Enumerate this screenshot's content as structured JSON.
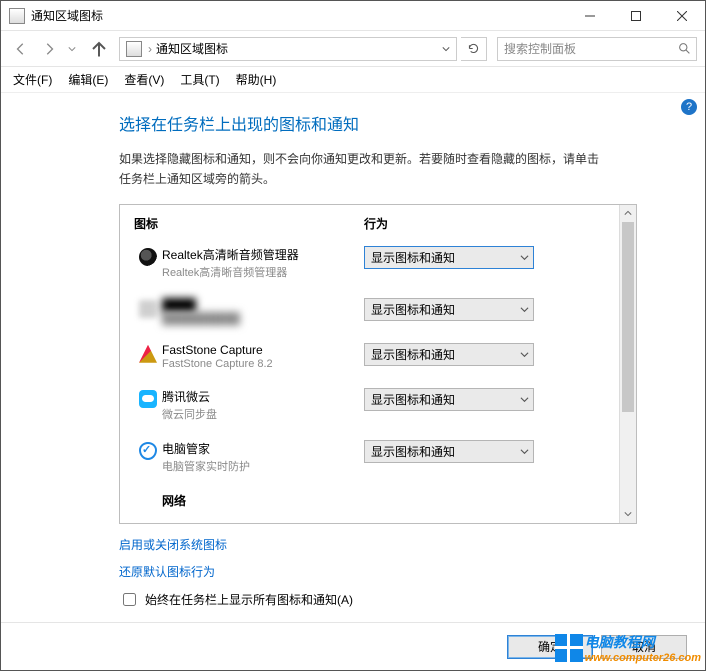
{
  "window": {
    "title": "通知区域图标"
  },
  "nav": {
    "breadcrumb": "通知区域图标",
    "search_placeholder": "搜索控制面板"
  },
  "menu": {
    "file": "文件(F)",
    "edit": "编辑(E)",
    "view": "查看(V)",
    "tools": "工具(T)",
    "help": "帮助(H)"
  },
  "page": {
    "heading": "选择在任务栏上出现的图标和通知",
    "description": "如果选择隐藏图标和通知，则不会向你通知更改和更新。若要随时查看隐藏的图标，请单击任务栏上通知区域旁的箭头。",
    "col_icon": "图标",
    "col_behavior": "行为",
    "link_system_icons": "启用或关闭系统图标",
    "link_restore": "还原默认图标行为",
    "checkbox_label": "始终在任务栏上显示所有图标和通知(A)",
    "last_row_label": "网络"
  },
  "rows": [
    {
      "title": "Realtek高清晰音频管理器",
      "subtitle": "Realtek高清晰音频管理器",
      "option": "显示图标和通知",
      "icon": "realtek",
      "highlight": true
    },
    {
      "title": "████",
      "subtitle": "██████████",
      "option": "显示图标和通知",
      "icon": "blur",
      "blurred": true
    },
    {
      "title": "FastStone Capture",
      "subtitle": "FastStone Capture 8.2",
      "option": "显示图标和通知",
      "icon": "fs"
    },
    {
      "title": "腾讯微云",
      "subtitle": "微云同步盘",
      "option": "显示图标和通知",
      "icon": "weiyun"
    },
    {
      "title": "电脑管家",
      "subtitle": "电脑管家实时防护",
      "option": "显示图标和通知",
      "icon": "guanjia"
    }
  ],
  "buttons": {
    "ok": "确定",
    "cancel": "取消"
  },
  "watermark": {
    "brand": "电脑教程网",
    "url": "www.computer26.com"
  }
}
